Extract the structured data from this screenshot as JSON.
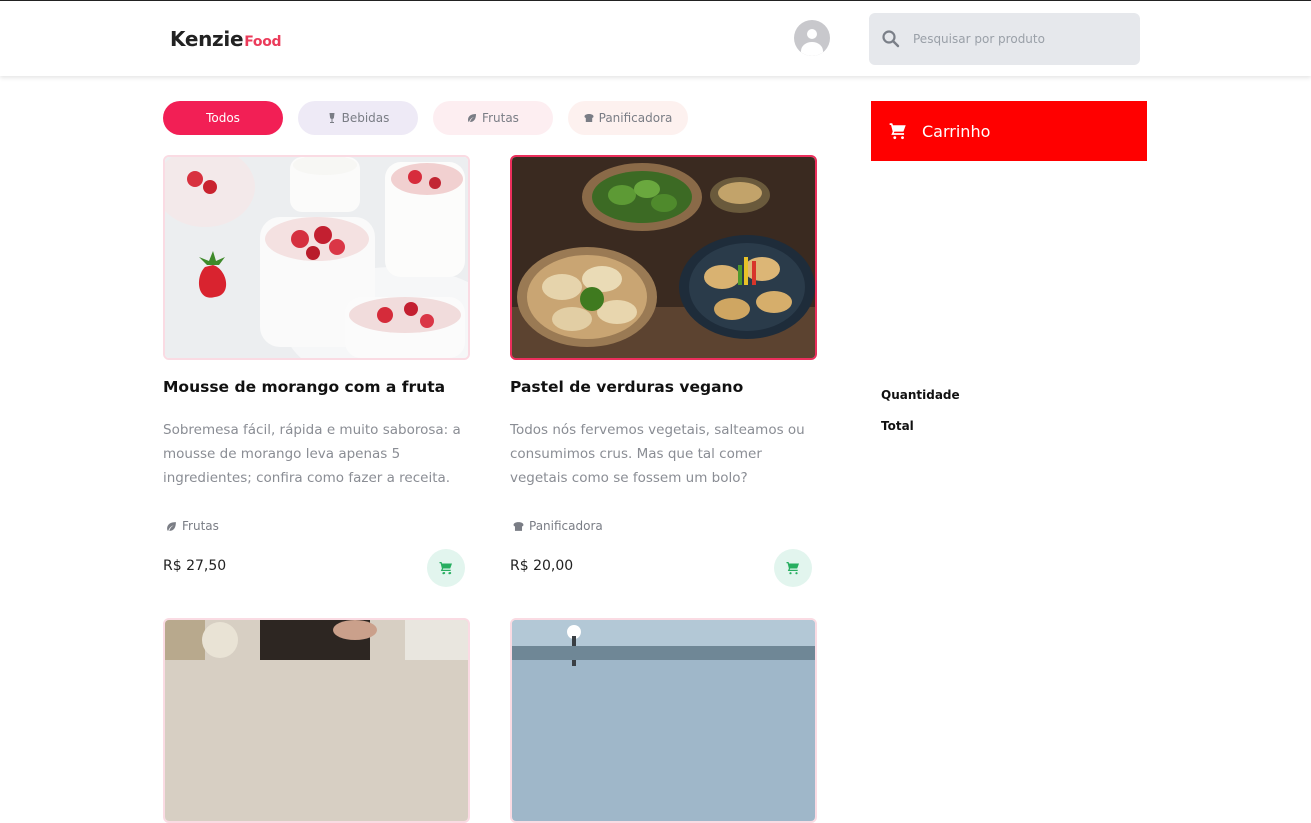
{
  "header": {
    "logo_main": "Kenzie",
    "logo_accent": "Food",
    "search_placeholder": "Pesquisar por produto",
    "search_icon": "search-icon",
    "avatar_icon": "user-avatar-icon"
  },
  "filters": [
    {
      "label": "Todos",
      "active": true
    },
    {
      "label": "Bebidas",
      "icon": "wine-glass-icon"
    },
    {
      "label": "Frutas",
      "icon": "leaf-icon"
    },
    {
      "label": "Panificadora",
      "icon": "bread-icon"
    }
  ],
  "products": [
    {
      "title": "Mousse de morango com a fruta",
      "description": "Sobremesa fácil, rápida e muito saborosa: a mousse de morango leva apenas 5 ingredientes; confira como fazer a receita.",
      "category": "Frutas",
      "category_icon": "leaf-icon",
      "price": "R$ 27,50"
    },
    {
      "title": "Pastel de verduras vegano",
      "description": "Todos nós fervemos vegetais, salteamos ou consumimos crus. Mas que tal comer vegetais como se fossem um bolo?",
      "category": "Panificadora",
      "category_icon": "bread-icon",
      "price": "R$ 20,00"
    }
  ],
  "cart": {
    "title": "Carrinho",
    "icon": "cart-icon",
    "quantity_label": "Quantidade",
    "total_label": "Total"
  },
  "colors": {
    "accent": "#eb3b5a",
    "todos_chip": "#f21f55",
    "cart_header": "#ff0000",
    "add_button_bg": "#e2f5ee",
    "add_button_icon": "#27ae60"
  }
}
